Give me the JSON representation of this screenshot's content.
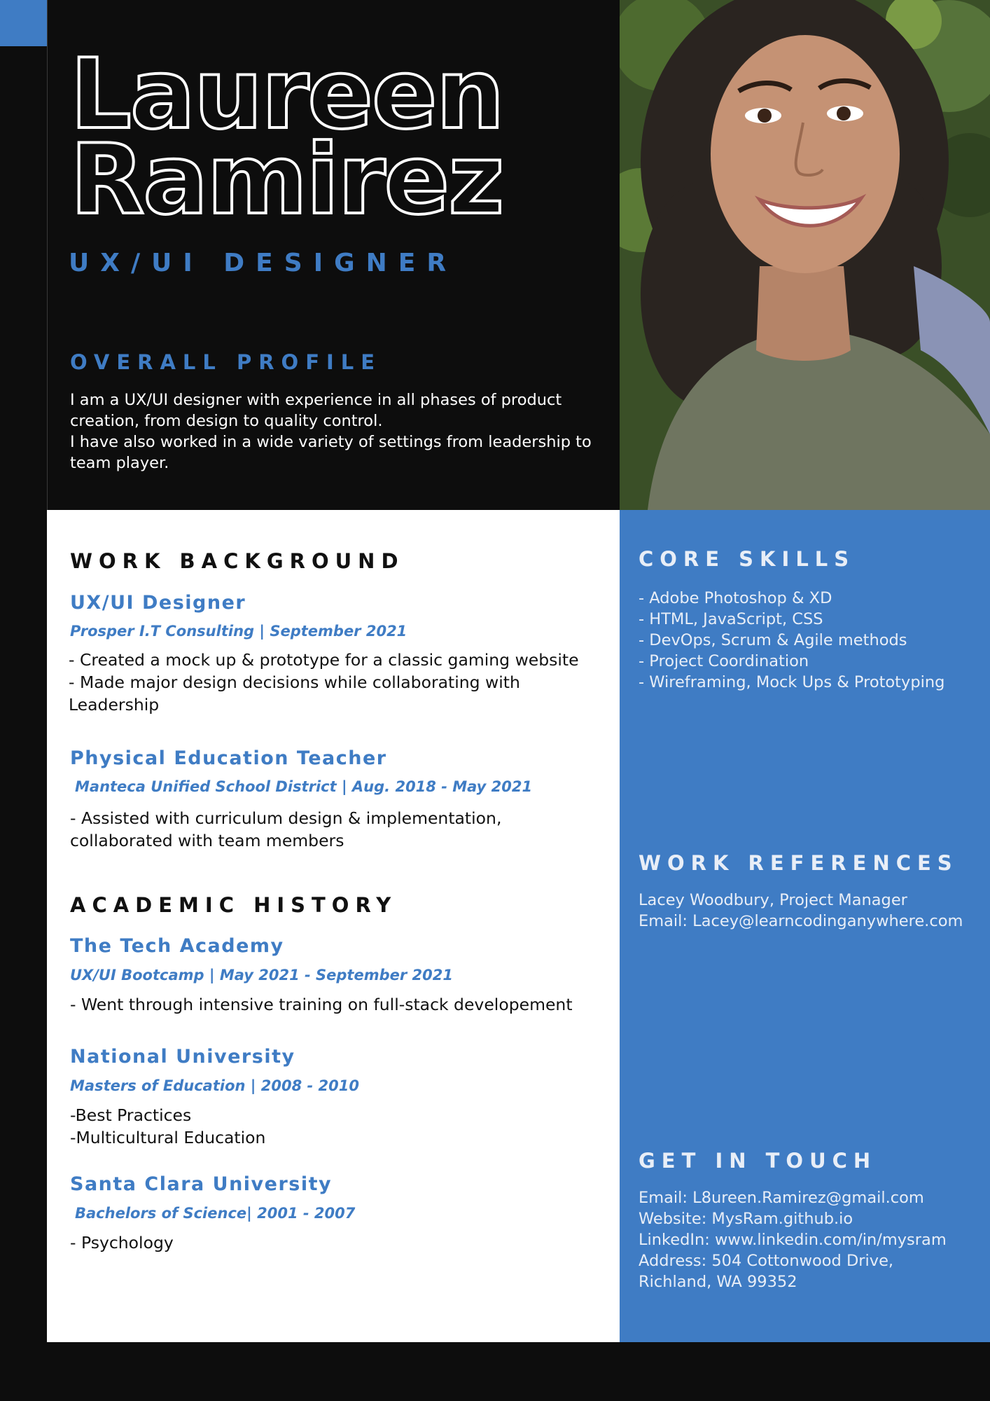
{
  "header": {
    "first_name": "Laureen",
    "last_name": "Ramirez",
    "job_title": "UX/UI DESIGNER",
    "profile_heading": "OVERALL PROFILE",
    "profile_lines": [
      "I am a UX/UI designer with experience in all phases of product",
      "creation, from design to quality control.",
      "I have also worked in a wide variety of settings from leadership to",
      "team player."
    ]
  },
  "work": {
    "heading": "WORK BACKGROUND",
    "jobs": [
      {
        "title": "UX/UI Designer",
        "sub": "Prosper I.T Consulting | September 2021",
        "lines": [
          "- Created a mock up & prototype for a classic gaming website",
          "- Made major design decisions while collaborating with",
          "Leadership"
        ]
      },
      {
        "title": "Physical Education Teacher",
        "sub": "Manteca Unified School District | Aug. 2018 - May 2021",
        "lines": [
          "- Assisted with curriculum design & implementation,",
          "collaborated with team members"
        ]
      }
    ]
  },
  "academic": {
    "heading": "ACADEMIC HISTORY",
    "schools": [
      {
        "title": "The Tech Academy",
        "sub": "UX/UI Bootcamp | May 2021 - September 2021",
        "lines": [
          "- Went through intensive training on full-stack developement"
        ]
      },
      {
        "title": "National University",
        "sub": "Masters of Education | 2008 - 2010",
        "lines": [
          "-Best Practices",
          "-Multicultural Education"
        ]
      },
      {
        "title": "Santa Clara University",
        "sub": "Bachelors of Science| 2001 - 2007",
        "lines": [
          "- Psychology"
        ]
      }
    ]
  },
  "sidebar": {
    "skills_heading": "CORE SKILLS",
    "skills": [
      "- Adobe Photoshop & XD",
      "- HTML, JavaScript, CSS",
      "- DevOps, Scrum & Agile methods",
      "- Project Coordination",
      "- Wireframing, Mock Ups & Prototyping"
    ],
    "references_heading": "WORK REFERENCES",
    "references": [
      "Lacey Woodbury, Project Manager",
      "Email: Lacey@learncodinganywhere.com"
    ],
    "contact_heading": "GET IN TOUCH",
    "contact": [
      "Email: L8ureen.Ramirez@gmail.com",
      "Website: MysRam.github.io",
      "LinkedIn: www.linkedin.com/in/mysram",
      "Address: 504 Cottonwood Drive,",
      "Richland, WA  99352"
    ]
  },
  "colors": {
    "accent": "#3f7cc4",
    "dark": "#0d0d0d",
    "text": "#111111",
    "sidebar_text": "#e8eef7"
  }
}
